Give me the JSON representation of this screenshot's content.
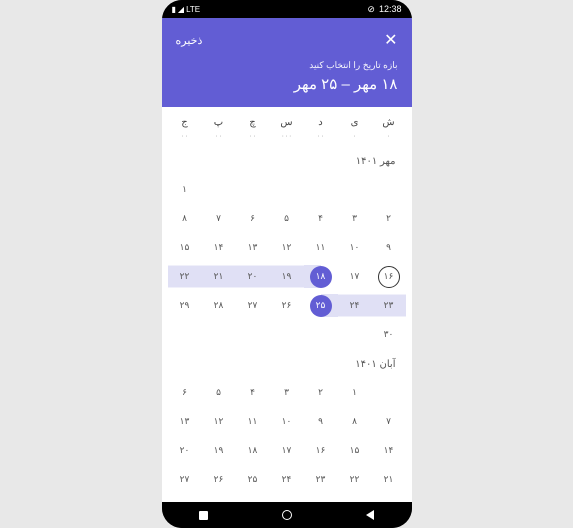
{
  "status": {
    "time": "12:38",
    "lte": "LTE"
  },
  "header": {
    "save": "ذخیره",
    "prompt": "بازه تاریخ را انتخاب کنید",
    "range": "۱۸ مهر – ۲۵ مهر"
  },
  "weekdays": [
    "ش",
    "ی",
    "د",
    "س",
    "چ",
    "پ",
    "ج"
  ],
  "dots": [
    "۰",
    "۰",
    "۰۰",
    "۰۰۰",
    "۰۰",
    "۰۰",
    "۰۰"
  ],
  "months": [
    {
      "label": "مهر ۱۴۰۱",
      "startCol": 6,
      "days": [
        "۱",
        "۲",
        "۳",
        "۴",
        "۵",
        "۶",
        "۷",
        "۸",
        "۹",
        "۱۰",
        "۱۱",
        "۱۲",
        "۱۳",
        "۱۴",
        "۱۵",
        "۱۶",
        "۱۷",
        "۱۸",
        "۱۹",
        "۲۰",
        "۲۱",
        "۲۲",
        "۲۳",
        "۲۴",
        "۲۵",
        "۲۶",
        "۲۷",
        "۲۸",
        "۲۹",
        "۳۰"
      ],
      "today": 15,
      "selStart": 17,
      "selEnd": 24
    },
    {
      "label": "آبان ۱۴۰۱",
      "startCol": 1,
      "days": [
        "۱",
        "۲",
        "۳",
        "۴",
        "۵",
        "۶",
        "۷",
        "۸",
        "۹",
        "۱۰",
        "۱۱",
        "۱۲",
        "۱۳",
        "۱۴",
        "۱۵",
        "۱۶",
        "۱۷",
        "۱۸",
        "۱۹",
        "۲۰",
        "۲۱",
        "۲۲",
        "۲۳",
        "۲۴",
        "۲۵",
        "۲۶",
        "۲۷"
      ]
    }
  ]
}
